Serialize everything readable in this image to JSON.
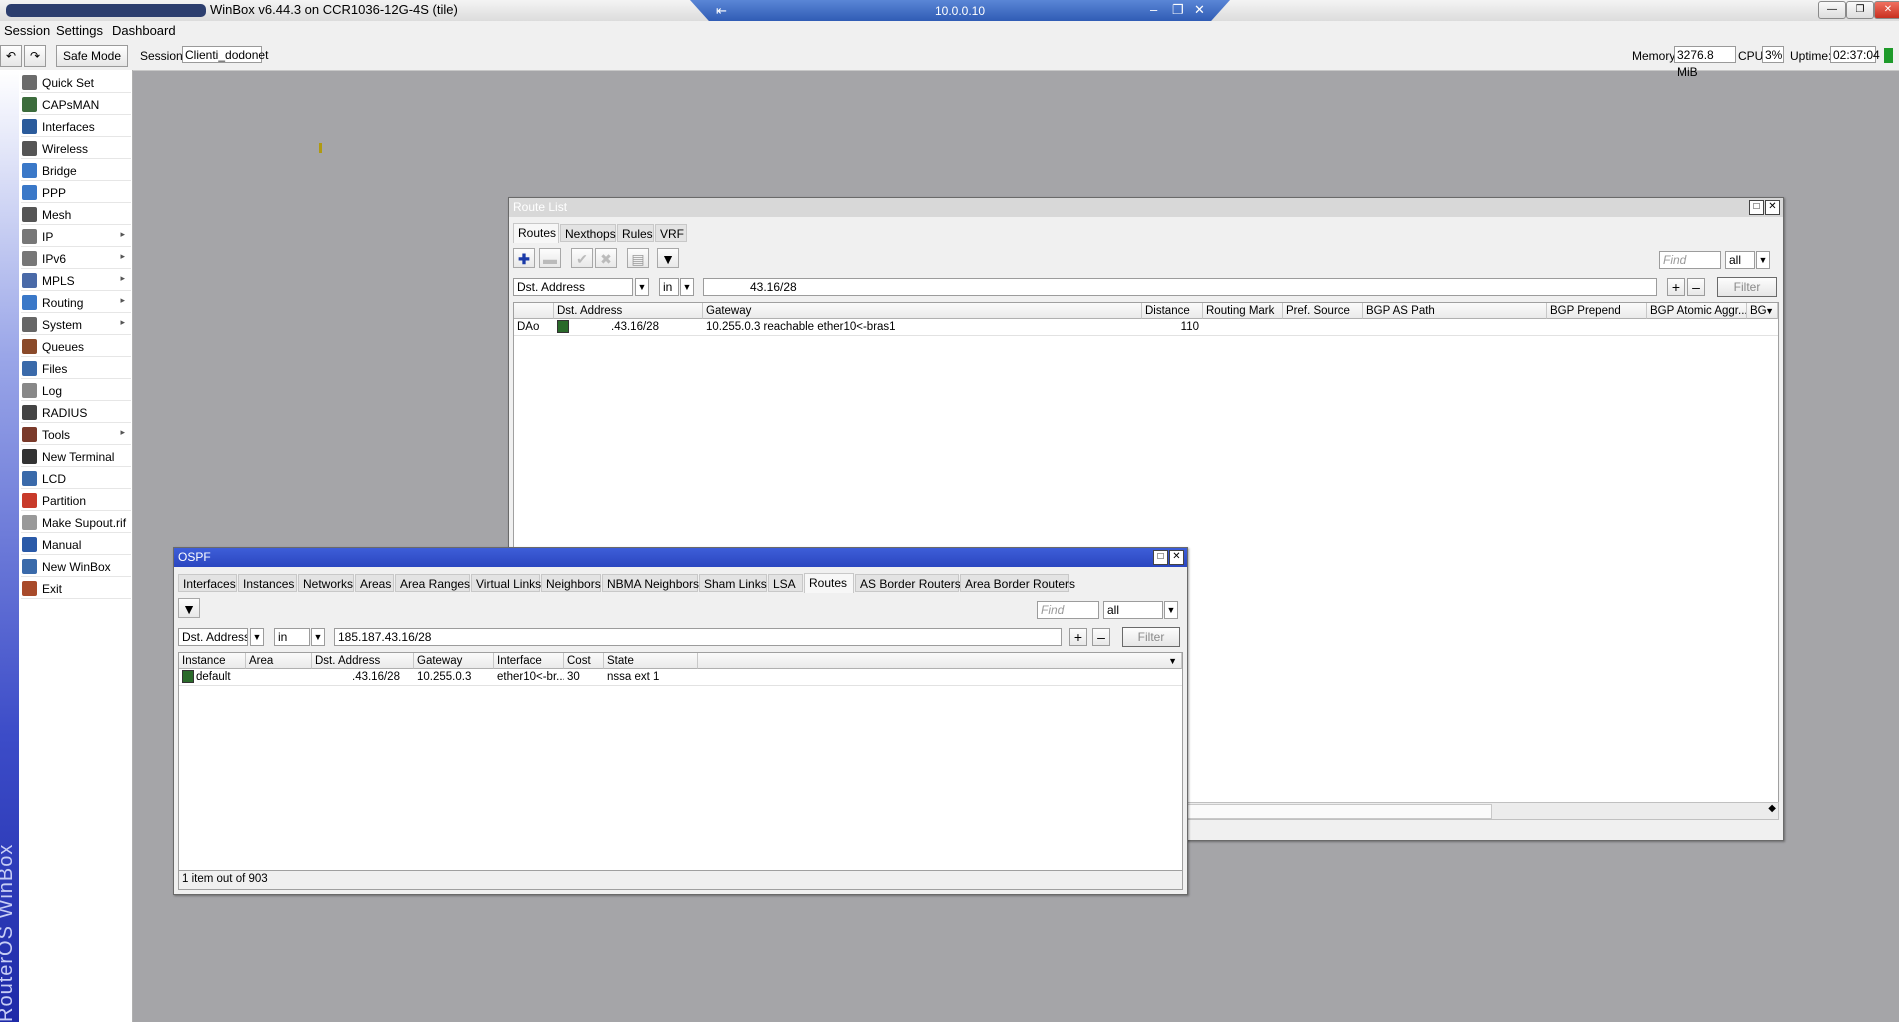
{
  "titlebar": {
    "title": "WinBox v6.44.3 on CCR1036-12G-4S (tile)",
    "remote_host": "10.0.0.10"
  },
  "menu": {
    "items": [
      "Session",
      "Settings",
      "Dashboard"
    ]
  },
  "toolbar": {
    "undo_icon": "undo-icon",
    "redo_icon": "redo-icon",
    "safe_mode_label": "Safe Mode",
    "session_label": "Session:",
    "session_value": "Clienti_dodonet",
    "memory_label": "Memory:",
    "memory_value": "3276.8 MiB",
    "cpu_label": "CPU:",
    "cpu_value": "3%",
    "uptime_label": "Uptime:",
    "uptime_value": "02:37:04"
  },
  "brand_text": "RouterOS WinBox",
  "sidebar": {
    "items": [
      {
        "label": "Quick Set",
        "icon": "quickset-icon",
        "color": "#6b6b6b",
        "submenu": false
      },
      {
        "label": "CAPsMAN",
        "icon": "capsman-icon",
        "color": "#3c6c3c",
        "submenu": false
      },
      {
        "label": "Interfaces",
        "icon": "interfaces-icon",
        "color": "#2b5b9b",
        "submenu": false
      },
      {
        "label": "Wireless",
        "icon": "wireless-icon",
        "color": "#555555",
        "submenu": false
      },
      {
        "label": "Bridge",
        "icon": "bridge-icon",
        "color": "#3a78c8",
        "submenu": false
      },
      {
        "label": "PPP",
        "icon": "ppp-icon",
        "color": "#3a78c8",
        "submenu": false
      },
      {
        "label": "Mesh",
        "icon": "mesh-icon",
        "color": "#555555",
        "submenu": false
      },
      {
        "label": "IP",
        "icon": "ip-icon",
        "color": "#777777",
        "submenu": true
      },
      {
        "label": "IPv6",
        "icon": "ipv6-icon",
        "color": "#777777",
        "submenu": true
      },
      {
        "label": "MPLS",
        "icon": "mpls-icon",
        "color": "#4a6aa8",
        "submenu": true
      },
      {
        "label": "Routing",
        "icon": "routing-icon",
        "color": "#3a78c8",
        "submenu": true
      },
      {
        "label": "System",
        "icon": "system-icon",
        "color": "#666666",
        "submenu": true
      },
      {
        "label": "Queues",
        "icon": "queues-icon",
        "color": "#8a4a2a",
        "submenu": false
      },
      {
        "label": "Files",
        "icon": "files-icon",
        "color": "#3a6aaa",
        "submenu": false
      },
      {
        "label": "Log",
        "icon": "log-icon",
        "color": "#888888",
        "submenu": false
      },
      {
        "label": "RADIUS",
        "icon": "radius-icon",
        "color": "#444444",
        "submenu": false
      },
      {
        "label": "Tools",
        "icon": "tools-icon",
        "color": "#7a3a2a",
        "submenu": true
      },
      {
        "label": "New Terminal",
        "icon": "terminal-icon",
        "color": "#333333",
        "submenu": false
      },
      {
        "label": "LCD",
        "icon": "lcd-icon",
        "color": "#3a6aaa",
        "submenu": false
      },
      {
        "label": "Partition",
        "icon": "partition-icon",
        "color": "#c83a2a",
        "submenu": false
      },
      {
        "label": "Make Supout.rif",
        "icon": "supout-icon",
        "color": "#999999",
        "submenu": false
      },
      {
        "label": "Manual",
        "icon": "manual-icon",
        "color": "#2a5aa8",
        "submenu": false
      },
      {
        "label": "New WinBox",
        "icon": "winbox-icon",
        "color": "#3a6aaa",
        "submenu": false
      },
      {
        "label": "Exit",
        "icon": "exit-icon",
        "color": "#a84a2a",
        "submenu": false
      }
    ]
  },
  "route_list": {
    "title": "Route List",
    "tabs": [
      "Routes",
      "Nexthops",
      "Rules",
      "VRF"
    ],
    "active_tab": "Routes",
    "find_placeholder": "Find",
    "find_scope": "all",
    "filter": {
      "field": "Dst. Address",
      "op": "in",
      "value": "43.16/28",
      "button": "Filter"
    },
    "columns": [
      "",
      "Dst. Address",
      "Gateway",
      "Distance",
      "Routing Mark",
      "Pref. Source",
      "BGP AS Path",
      "BGP Prepend",
      "BGP Atomic Aggr...",
      "BG"
    ],
    "rows": [
      {
        "flags": "DAo",
        "dst": ".43.16/28",
        "gateway": "10.255.0.3 reachable ether10<-bras1",
        "distance": "110",
        "routing_mark": "",
        "pref_source": "",
        "bgp_as_path": "",
        "bgp_prepend": "",
        "bgp_atomic": ""
      }
    ]
  },
  "ospf": {
    "title": "OSPF",
    "tabs": [
      "Interfaces",
      "Instances",
      "Networks",
      "Areas",
      "Area Ranges",
      "Virtual Links",
      "Neighbors",
      "NBMA Neighbors",
      "Sham Links",
      "LSA",
      "Routes",
      "AS Border Routers",
      "Area Border Routers"
    ],
    "active_tab": "Routes",
    "find_placeholder": "Find",
    "find_scope": "all",
    "filter": {
      "field": "Dst. Address",
      "op": "in",
      "value": "185.187.43.16/28",
      "button": "Filter"
    },
    "columns": [
      "Instance",
      "Area",
      "Dst. Address",
      "Gateway",
      "Interface",
      "Cost",
      "State"
    ],
    "rows": [
      {
        "instance": "default",
        "area": "",
        "dst": ".43.16/28",
        "gateway": "10.255.0.3",
        "interface": "ether10<-br...",
        "cost": "30",
        "state": "nssa ext 1"
      }
    ],
    "status": "1 item out of 903"
  }
}
